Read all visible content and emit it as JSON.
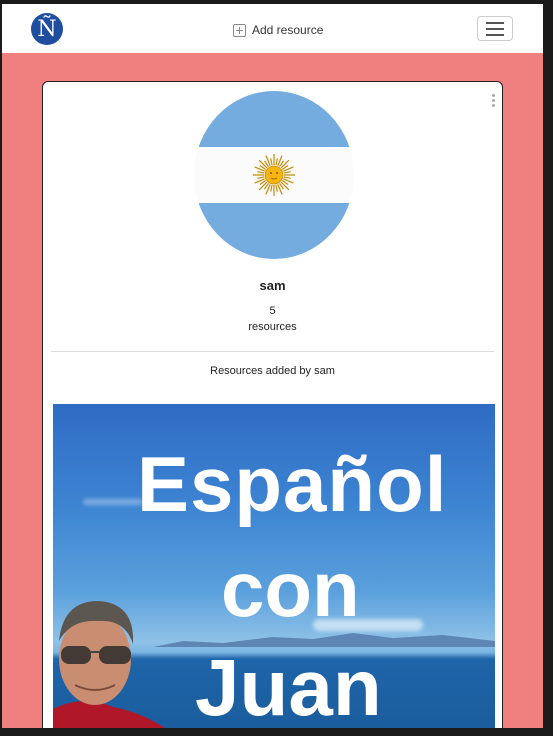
{
  "navbar": {
    "logo_letter": "Ñ",
    "add_resource_label": "Add resource"
  },
  "profile": {
    "username": "sam",
    "resource_count": "5",
    "resource_count_label": "resources",
    "section_title": "Resources added by sam"
  },
  "resource": {
    "image_text_line1": "Español",
    "image_text_line2": "con",
    "image_text_line3": "Juan"
  },
  "colors": {
    "page_background": "#f08080",
    "flag_blue": "#74acdf",
    "flag_sun": "#f6b40e",
    "logo_blue": "#1f4e9e"
  },
  "icons": [
    "logo-icon",
    "plus-square-icon",
    "hamburger-menu-icon",
    "more-vertical-icon",
    "argentina-flag-avatar"
  ]
}
